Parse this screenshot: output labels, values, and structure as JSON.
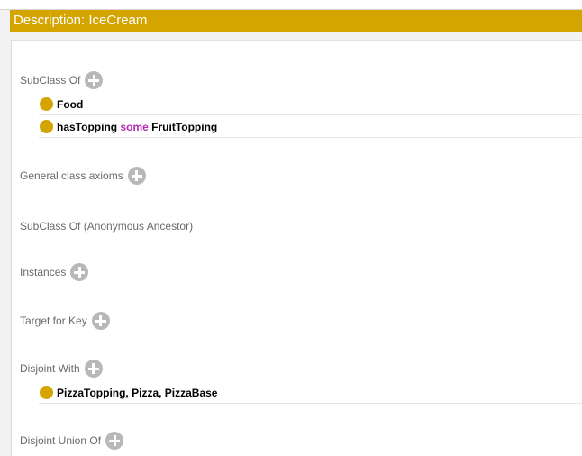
{
  "header": {
    "title": "Description: IceCream"
  },
  "sections": {
    "subclass_of": {
      "label": "SubClass Of",
      "items": [
        {
          "text": "Food"
        },
        {
          "prop": "hasTopping",
          "keyword": "some",
          "filler": "FruitTopping"
        }
      ]
    },
    "general_class_axioms": {
      "label": "General class axioms"
    },
    "subclass_anon": {
      "label": "SubClass Of (Anonymous Ancestor)"
    },
    "instances": {
      "label": "Instances"
    },
    "target_for_key": {
      "label": "Target for Key"
    },
    "disjoint_with": {
      "label": "Disjoint With",
      "items": [
        {
          "text": "PizzaTopping, Pizza, PizzaBase"
        }
      ]
    },
    "disjoint_union_of": {
      "label": "Disjoint Union Of"
    }
  },
  "icons": {
    "add": "add-icon",
    "class_bullet": "class-bullet-icon"
  },
  "colors": {
    "header_bg": "#d4a400",
    "bullet": "#d4a400",
    "keyword": "#b12bb1",
    "add_button": "#b8b8b8"
  }
}
